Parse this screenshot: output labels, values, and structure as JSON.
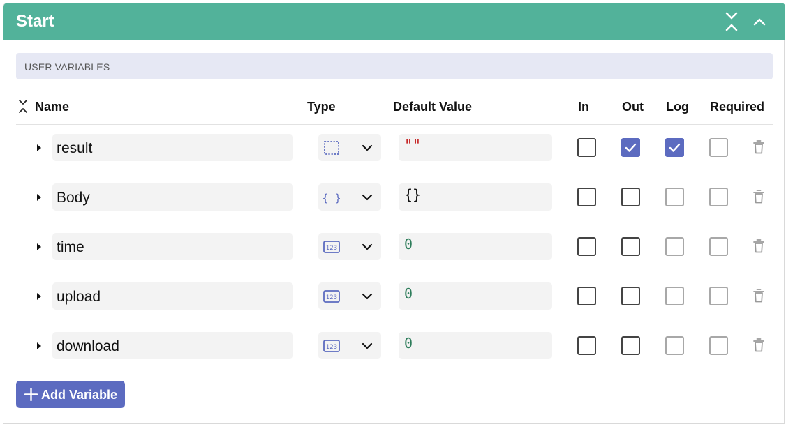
{
  "panel": {
    "title": "Start",
    "color": "#52b29a",
    "collapse_all_icon": "collapse-vertical-icon",
    "collapse_icon": "chevron-up-icon"
  },
  "section": {
    "label": "USER VARIABLES"
  },
  "columns": {
    "name": "Name",
    "type": "Type",
    "default_value": "Default Value",
    "in": "In",
    "out": "Out",
    "log": "Log",
    "required": "Required"
  },
  "variables": [
    {
      "name": "result",
      "type_icon": "any-type-icon",
      "default_value": "\"\"",
      "value_kind": "string",
      "in": false,
      "out": true,
      "log": true,
      "log_enabled": true,
      "required": false
    },
    {
      "name": "Body",
      "type_icon": "object-type-icon",
      "default_value": "{}",
      "value_kind": "object",
      "in": false,
      "out": false,
      "log": false,
      "log_enabled": false,
      "required": false
    },
    {
      "name": "time",
      "type_icon": "number-type-icon",
      "default_value": "0",
      "value_kind": "number",
      "in": false,
      "out": false,
      "log": false,
      "log_enabled": false,
      "required": false
    },
    {
      "name": "upload",
      "type_icon": "number-type-icon",
      "default_value": "0",
      "value_kind": "number",
      "in": false,
      "out": false,
      "log": false,
      "log_enabled": false,
      "required": false
    },
    {
      "name": "download",
      "type_icon": "number-type-icon",
      "default_value": "0",
      "value_kind": "number",
      "in": false,
      "out": false,
      "log": false,
      "log_enabled": false,
      "required": false
    }
  ],
  "add_button": {
    "label": "Add Variable",
    "color": "#5c6bc0"
  }
}
